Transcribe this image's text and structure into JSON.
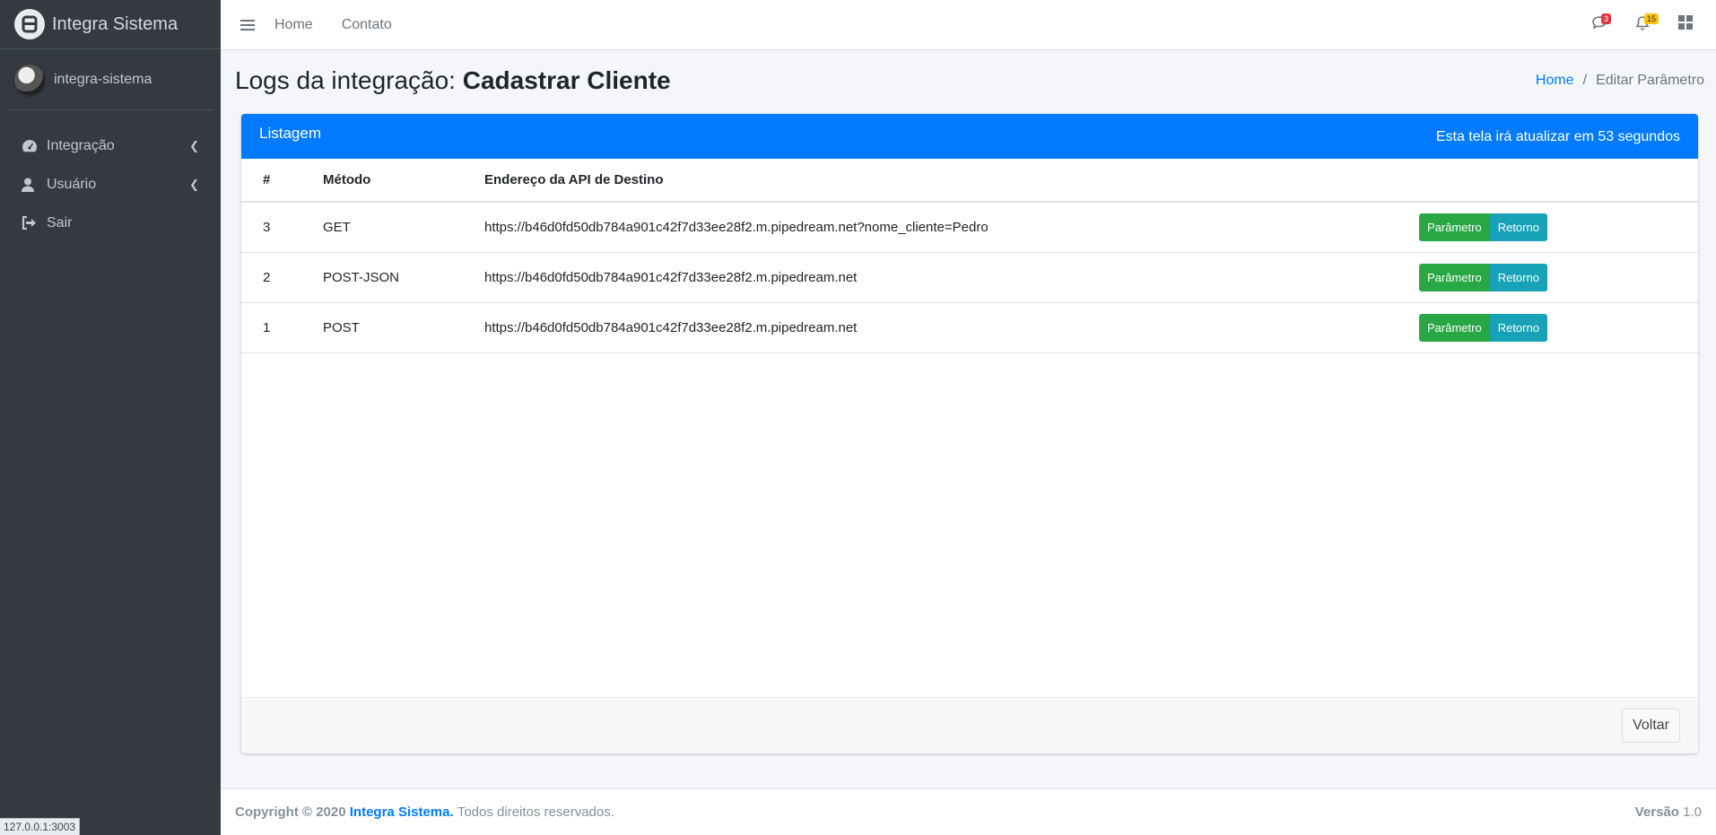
{
  "sidebar": {
    "brand": "Integra Sistema",
    "user": "integra-sistema",
    "items": [
      {
        "label": "Integração",
        "icon": "dashboard-icon"
      },
      {
        "label": "Usuário",
        "icon": "user-icon"
      },
      {
        "label": "Sair",
        "icon": "sign-out-icon"
      }
    ],
    "status_url": "127.0.0.1:3003"
  },
  "topbar": {
    "links": [
      "Home",
      "Contato"
    ],
    "messages_count": "3",
    "notifications_count": "15"
  },
  "header": {
    "title_prefix": "Logs da integração:",
    "title_bold": "Cadastrar Cliente",
    "breadcrumb": {
      "home": "Home",
      "separator": "/",
      "current": "Editar Parâmetro"
    }
  },
  "card": {
    "title": "Listagem",
    "refresh_text": "Esta tela irá atualizar em 53 segundos",
    "columns": [
      "#",
      "Método",
      "Endereço da API de Destino"
    ],
    "rows": [
      {
        "id": "3",
        "method": "GET",
        "url": "https://b46d0fd50db784a901c42f7d33ee28f2.m.pipedream.net?nome_cliente=Pedro"
      },
      {
        "id": "2",
        "method": "POST-JSON",
        "url": "https://b46d0fd50db784a901c42f7d33ee28f2.m.pipedream.net"
      },
      {
        "id": "1",
        "method": "POST",
        "url": "https://b46d0fd50db784a901c42f7d33ee28f2.m.pipedream.net"
      }
    ],
    "btn_param": "Parâmetro",
    "btn_return": "Retorno",
    "back_label": "Voltar"
  },
  "footer": {
    "copyright": "Copyright © 2020",
    "brand": "Integra Sistema.",
    "rights": "Todos direitos reservados.",
    "version_label": "Versão",
    "version": "1.0"
  },
  "colors": {
    "primary": "#007bff",
    "success": "#28a745",
    "info": "#17a2b8",
    "sidebar": "#343a40",
    "danger": "#dc3545",
    "warning": "#ffc107"
  }
}
